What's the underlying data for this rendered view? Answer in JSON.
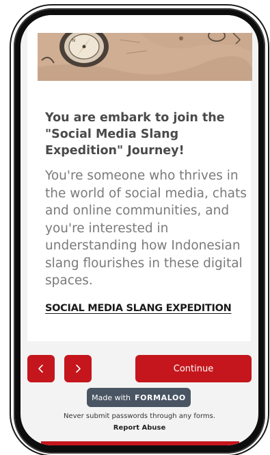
{
  "card": {
    "title": "You are embark to join the \"Social Media Slang Expedition\" Journey!",
    "description": "You're someone who thrives in the world of social media, chats and online communities, and you're interested in understanding how Indonesian slang flourishes in these digital spaces.",
    "link_text": "SOCIAL MEDIA SLANG EXPEDITION"
  },
  "navigation": {
    "prev_icon": "chevron-left-icon",
    "next_icon": "chevron-right-icon",
    "continue_label": "Continue"
  },
  "footer": {
    "made_with": "Made with",
    "brand": "FORMALOO",
    "notice": "Never submit passwords through any forms.",
    "report": "Report Abuse"
  },
  "colors": {
    "accent": "#c4161c",
    "badge_bg": "#4a5563",
    "title": "#4a4a4a",
    "body_text": "#7a7a7a"
  }
}
